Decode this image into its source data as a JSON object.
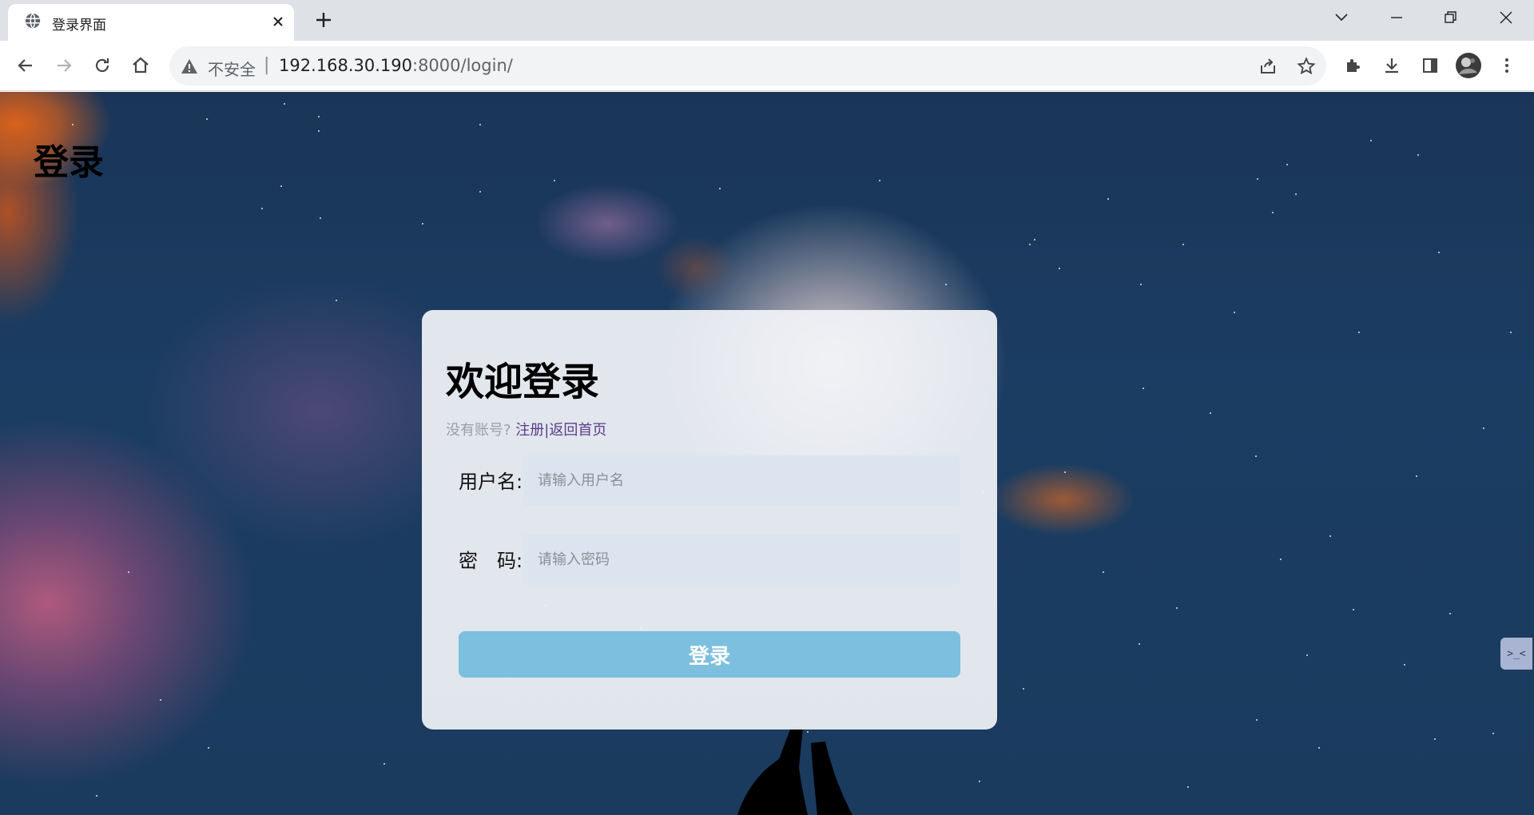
{
  "browser": {
    "tab_title": "登录界面",
    "security_label": "不安全",
    "url_host": "192.168.30.190",
    "url_rest": ":8000/login/",
    "icons": {
      "favicon": "globe-icon",
      "close": "close-icon",
      "new_tab": "plus-icon",
      "back": "back-arrow-icon",
      "forward": "forward-arrow-icon",
      "reload": "reload-icon",
      "home": "home-icon",
      "warning": "warning-icon",
      "share": "share-icon",
      "bookmark": "star-icon",
      "extensions": "puzzle-icon",
      "download": "download-icon",
      "side_panel": "side-panel-icon",
      "profile": "avatar",
      "menu": "kebab-menu-icon"
    }
  },
  "page": {
    "title": "登录"
  },
  "login": {
    "heading": "欢迎登录",
    "no_account": "没有账号?",
    "register_link": "注册",
    "separator": "|",
    "home_link": "返回首页",
    "username_label": "用户名:",
    "username_placeholder": "请输入用户名",
    "password_label": "密　码:",
    "password_placeholder": "请输入密码",
    "submit_label": "登录"
  },
  "side_widget": {
    "label": ">_<"
  },
  "colors": {
    "button": "#7dbfde",
    "link": "#5a3d8a",
    "input_bg": "#dce5ef"
  }
}
